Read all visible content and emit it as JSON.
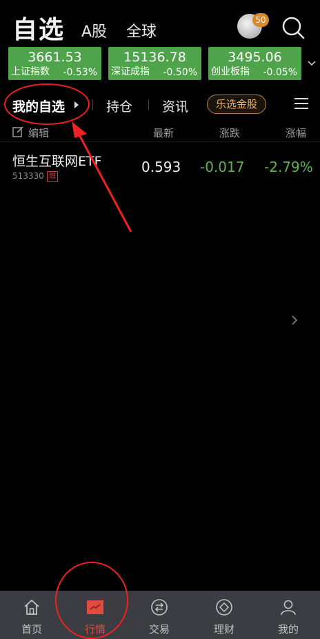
{
  "header": {
    "title": "自选",
    "tabs": [
      "A股",
      "全球"
    ],
    "avatar_badge": "50"
  },
  "indices": [
    {
      "value": "3661.53",
      "name": "上证指数",
      "change": "-0.53%"
    },
    {
      "value": "15136.78",
      "name": "深证成指",
      "change": "-0.50%"
    },
    {
      "value": "3495.06",
      "name": "创业板指",
      "change": "-0.05%"
    }
  ],
  "subtabs": {
    "my_watchlist": "我的自选",
    "holdings": "持仓",
    "news": "资讯",
    "gold_pick": "乐选金股"
  },
  "columns": {
    "edit": "编辑",
    "latest": "最新",
    "change": "涨跌",
    "change_pct": "涨幅"
  },
  "rows": [
    {
      "name": "恒生互联网ETF",
      "code": "513330",
      "badge": "融",
      "latest": "0.593",
      "change": "-0.017",
      "change_pct": "-2.79%"
    }
  ],
  "bottom_nav": [
    {
      "label": "首页",
      "icon": "home-icon"
    },
    {
      "label": "行情",
      "icon": "market-icon"
    },
    {
      "label": "交易",
      "icon": "trade-icon"
    },
    {
      "label": "理财",
      "icon": "finance-icon"
    },
    {
      "label": "我的",
      "icon": "profile-icon"
    }
  ],
  "colors": {
    "card_green": "#4fa34a",
    "down_green": "#5fb44f",
    "accent_red": "#e24a3f",
    "gold": "#e8b575",
    "annotation_red": "#e22222"
  }
}
